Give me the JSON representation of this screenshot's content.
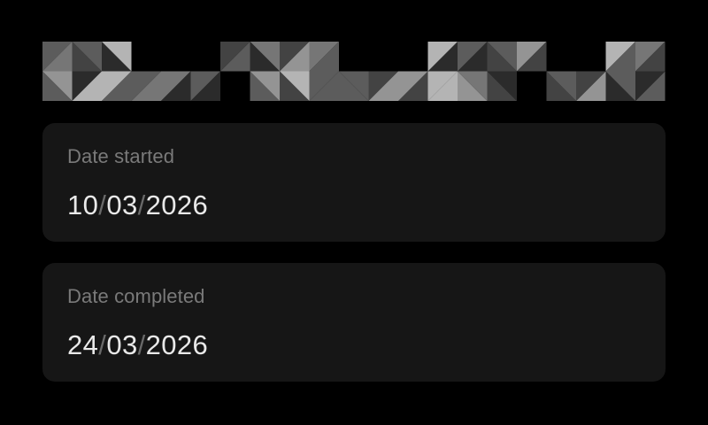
{
  "banner": {
    "icon": "pixel-triangle-pattern",
    "colors": [
      "#2b2b2b",
      "#434343",
      "#5c5c5c",
      "#767676",
      "#949494",
      "#b4b4b4"
    ]
  },
  "fields": {
    "started": {
      "label": "Date started",
      "day": "10",
      "month": "03",
      "year": "2026",
      "separator": "/"
    },
    "completed": {
      "label": "Date completed",
      "day": "24",
      "month": "03",
      "year": "2026",
      "separator": "/"
    }
  },
  "colors": {
    "background": "#000000",
    "card": "#161616",
    "label": "#7a7a7a",
    "value": "#e9e9e9",
    "separator": "#6a6a6a"
  }
}
